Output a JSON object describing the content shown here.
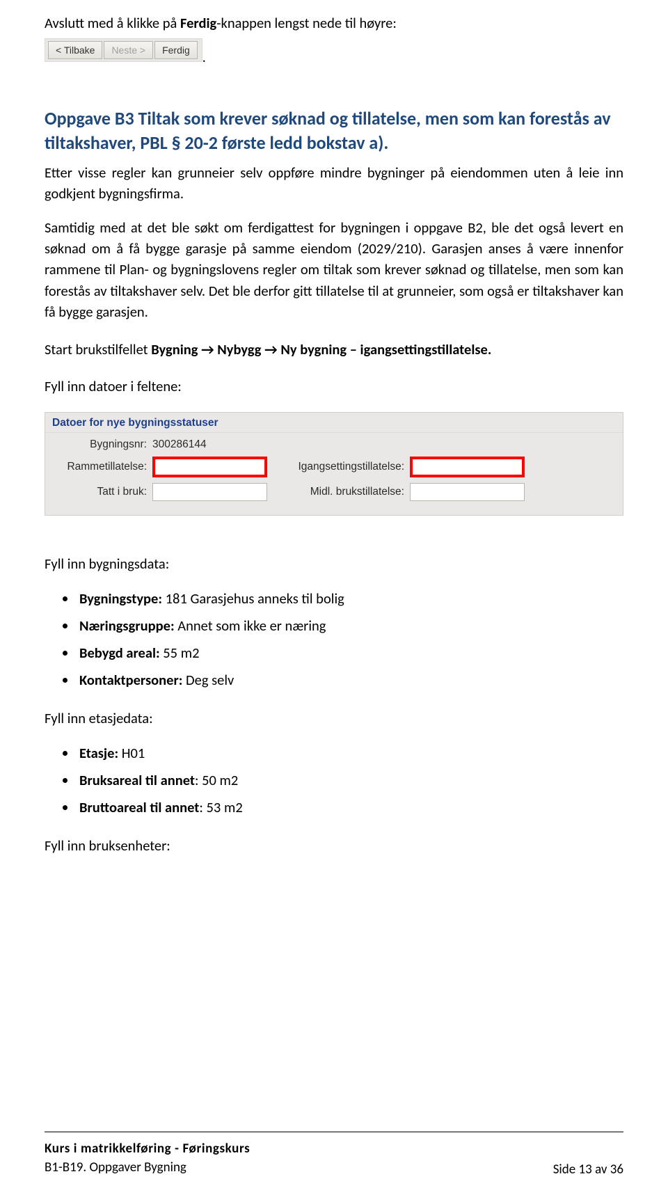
{
  "intro": {
    "prefix": "Avslutt med å klikke på ",
    "bold": "Ferdig",
    "suffix": "-knappen lengst nede til høyre:"
  },
  "wizard": {
    "back": "<  Tilbake",
    "next": "Neste  >",
    "finish": "Ferdig",
    "trailing": "."
  },
  "heading": "Oppgave B3 Tiltak som krever søknad og tillatelse, men som kan forestås av tiltakshaver, PBL § 20-2 første ledd bokstav a).",
  "p1": "Etter visse regler kan grunneier selv oppføre mindre bygninger på eiendommen uten å leie inn godkjent bygningsfirma.",
  "p2": "Samtidig med at det ble søkt om ferdigattest for bygningen i oppgave B2, ble det også levert en søknad om å få bygge garasje på samme eiendom (2029/210). Garasjen anses å være innenfor rammene til Plan- og bygningslovens regler om tiltak som krever søknad og tillatelse, men som kan forestås av tiltakshaver selv. Det ble derfor gitt tillatelse til at grunneier, som også er tiltakshaver kan få bygge garasjen.",
  "p3a": "Start brukstilfellet ",
  "p3b": "Bygning",
  "p3arrow": " → ",
  "p3c": "Nybygg",
  "p3d": "Ny bygning – igangsettingstillatelse.",
  "p4": "Fyll inn datoer i feltene:",
  "panel": {
    "header": "Datoer for nye bygningsstatuser",
    "bygningsnr_label": "Bygningsnr:",
    "bygningsnr_value": "300286144",
    "rammetillatelse_label": "Rammetillatelse:",
    "igangsettingstillatelse_label": "Igangsettingstillatelse:",
    "tatt_i_bruk_label": "Tatt i bruk:",
    "midl_label": "Midl. brukstillatelse:"
  },
  "s1": "Fyll inn bygningsdata:",
  "list1": [
    {
      "b": "Bygningstype:",
      "r": " 181 Garasjehus anneks til bolig"
    },
    {
      "b": "Næringsgruppe:",
      "r": " Annet som ikke er næring"
    },
    {
      "b": "Bebygd areal:",
      "r": " 55 m2"
    },
    {
      "b": "Kontaktpersoner:",
      "r": " Deg selv"
    }
  ],
  "s2": "Fyll inn etasjedata:",
  "list2": [
    {
      "b": "Etasje:",
      "r": " H01"
    },
    {
      "b": "Bruksareal til annet",
      "r": ": 50 m2"
    },
    {
      "b": "Bruttoareal til annet",
      "r": ": 53 m2"
    }
  ],
  "s3": "Fyll inn bruksenheter:",
  "footer": {
    "title": "Kurs i matrikkelføring - Føringskurs",
    "subtitle": "B1-B19. Oppgaver Bygning",
    "page": "Side 13 av 36"
  }
}
